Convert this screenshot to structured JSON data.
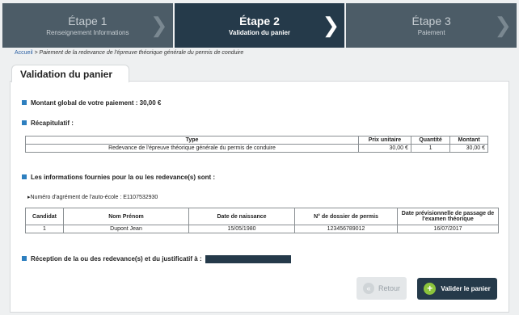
{
  "steps": [
    {
      "title": "Étape 1",
      "subtitle": "Renseignement Informations"
    },
    {
      "title": "Étape 2",
      "subtitle": "Validation du panier"
    },
    {
      "title": "Étape 3",
      "subtitle": "Paiement"
    }
  ],
  "breadcrumb": {
    "home": "Accueil",
    "path": " > Paiement de la redevance de l'épreuve théorique générale du permis de conduire"
  },
  "page": {
    "tab_title": "Validation du panier"
  },
  "sections": {
    "amount": "Montant global de votre paiement : 30,00 €",
    "summary": "Récapitulatif :",
    "info": "Les informations fournies pour la ou les redevance(s) sont :",
    "reception": "Réception de la ou des redevance(s) et du justificatif à :"
  },
  "summary_table": {
    "headers": [
      "Type",
      "Prix unitaire",
      "Quantité",
      "Montant"
    ],
    "row": [
      "Redevance de l'épreuve théorique générale du permis de conduire",
      "30,00 €",
      "1",
      "30,00 €"
    ]
  },
  "agrement": "Numéro d'agrément de l'auto-école : E1107532930",
  "candidates_table": {
    "headers": [
      "Candidat",
      "Nom Prénom",
      "Date de naissance",
      "N° de dossier de permis",
      "Date prévisionnelle de passage de l'examen théorique"
    ],
    "row": [
      "1",
      "Dupont Jean",
      "15/05/1980",
      "123456789012",
      "16/07/2017"
    ]
  },
  "buttons": {
    "back": "Retour",
    "validate": "Valider le panier"
  }
}
